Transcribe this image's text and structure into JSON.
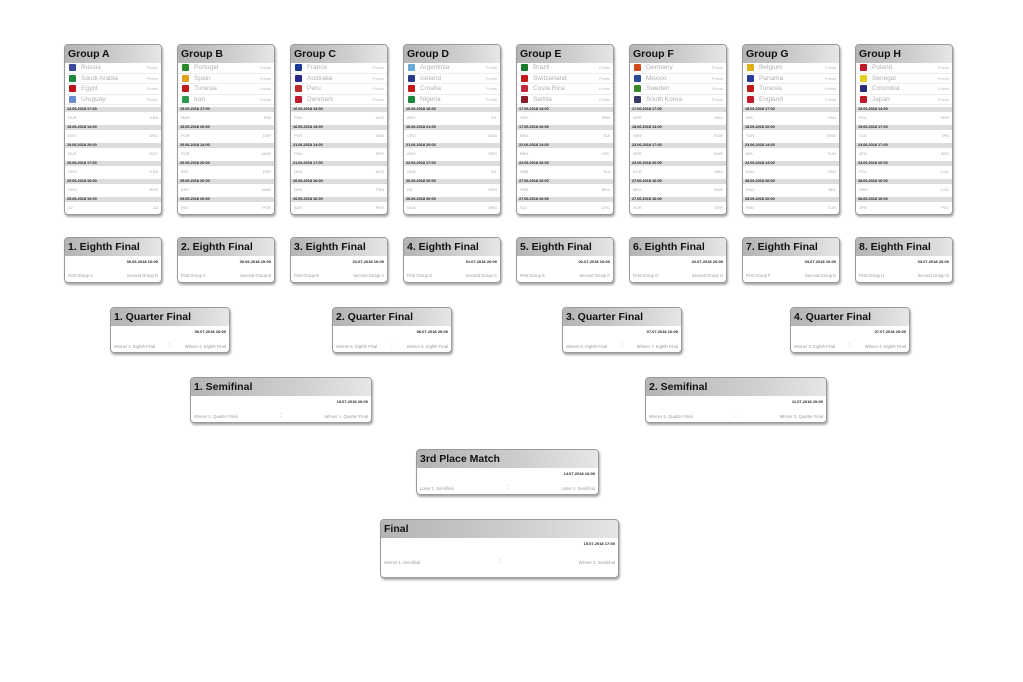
{
  "groups": [
    {
      "title": "Group A",
      "points_label": "Points",
      "teams": [
        {
          "name": "Russia",
          "color": "#3a4a9a"
        },
        {
          "name": "Saudi Arabia",
          "color": "#1a8a3a"
        },
        {
          "name": "Egypt",
          "color": "#c0141c"
        },
        {
          "name": "Uruguay",
          "color": "#6a8ad0"
        }
      ],
      "matches": [
        {
          "date": "14.06.2018 17:00",
          "home": "RUS",
          "away": "KSA"
        },
        {
          "date": "15.06.2018 14:00",
          "home": "EGY",
          "away": "URU"
        },
        {
          "date": "19.06.2018 20:00",
          "home": "RUS",
          "away": "EGY"
        },
        {
          "date": "20.06.2018 17:00",
          "home": "URU",
          "away": "KSA"
        },
        {
          "date": "25.06.2018 16:00",
          "home": "URU",
          "away": "RUS"
        },
        {
          "date": "25.06.2018 16:00",
          "home": "A2",
          "away": "A3"
        }
      ]
    },
    {
      "title": "Group B",
      "points_label": "Points",
      "teams": [
        {
          "name": "Portugal",
          "color": "#2a8a2a"
        },
        {
          "name": "Spain",
          "color": "#e0a020"
        },
        {
          "name": "Tunesia",
          "color": "#c01a1a"
        },
        {
          "name": "Iran",
          "color": "#2a9a4a"
        }
      ],
      "matches": [
        {
          "date": "15.06.2018 17:00",
          "home": "MAR",
          "away": "IRN"
        },
        {
          "date": "15.06.2018 20:00",
          "home": "POR",
          "away": "ESP"
        },
        {
          "date": "20.06.2018 14:00",
          "home": "POR",
          "away": "MAR"
        },
        {
          "date": "20.06.2018 20:00",
          "home": "IRN",
          "away": "ESP"
        },
        {
          "date": "25.06.2018 20:00",
          "home": "ESP",
          "away": "MAR"
        },
        {
          "date": "25.06.2018 20:00",
          "home": "IRN",
          "away": "POR"
        }
      ]
    },
    {
      "title": "Group C",
      "points_label": "Points",
      "teams": [
        {
          "name": "France",
          "color": "#1a3a9a"
        },
        {
          "name": "Australia",
          "color": "#2a2a8a"
        },
        {
          "name": "Peru",
          "color": "#c02a2a"
        },
        {
          "name": "Denmark",
          "color": "#c01a2a"
        }
      ],
      "matches": [
        {
          "date": "16.06.2018 13:00",
          "home": "FRA",
          "away": "AUS"
        },
        {
          "date": "16.06.2018 19:00",
          "home": "PER",
          "away": "DEN"
        },
        {
          "date": "21.06.2018 14:00",
          "home": "FRA",
          "away": "PER"
        },
        {
          "date": "21.06.2018 17:00",
          "home": "DEN",
          "away": "AUS"
        },
        {
          "date": "26.06.2018 16:00",
          "home": "DEN",
          "away": "FRA"
        },
        {
          "date": "26.06.2018 16:00",
          "home": "AUS",
          "away": "PER"
        }
      ]
    },
    {
      "title": "Group D",
      "points_label": "Points",
      "teams": [
        {
          "name": "Argentinia",
          "color": "#6aaad8"
        },
        {
          "name": "Iceland",
          "color": "#2a3a8a"
        },
        {
          "name": "Croatia",
          "color": "#c01a1a"
        },
        {
          "name": "Nigeria",
          "color": "#1a8a3a"
        }
      ],
      "matches": [
        {
          "date": "16.06.2018 16:00",
          "home": "ARG",
          "away": "ISL"
        },
        {
          "date": "16.06.2018 21:00",
          "home": "CRO",
          "away": "NGA"
        },
        {
          "date": "21.06.2018 20:00",
          "home": "ARG",
          "away": "CRO"
        },
        {
          "date": "22.06.2018 17:00",
          "home": "NGA",
          "away": "ISL"
        },
        {
          "date": "26.06.2018 20:00",
          "home": "ISL",
          "away": "CRO"
        },
        {
          "date": "26.06.2018 20:00",
          "home": "NGA",
          "away": "ARG"
        }
      ]
    },
    {
      "title": "Group E",
      "points_label": "Points",
      "teams": [
        {
          "name": "Brazil",
          "color": "#1a7a2a"
        },
        {
          "name": "Switzerland",
          "color": "#c01a1a"
        },
        {
          "name": "Costa Rica",
          "color": "#c02a3a"
        },
        {
          "name": "Serbia",
          "color": "#8a1a2a"
        }
      ],
      "matches": [
        {
          "date": "17.06.2018 14:00",
          "home": "CRC",
          "away": "SRB"
        },
        {
          "date": "17.06.2018 20:00",
          "home": "BRA",
          "away": "SUI"
        },
        {
          "date": "22.06.2018 14:00",
          "home": "BRA",
          "away": "CRC"
        },
        {
          "date": "22.06.2018 20:00",
          "home": "SRB",
          "away": "SUI"
        },
        {
          "date": "27.06.2018 20:00",
          "home": "SRB",
          "away": "BRA"
        },
        {
          "date": "27.06.2018 20:00",
          "home": "SUI",
          "away": "CRC"
        }
      ]
    },
    {
      "title": "Group F",
      "points_label": "Points",
      "teams": [
        {
          "name": "Germany",
          "color": "#d04a1a"
        },
        {
          "name": "Mexico",
          "color": "#2a4a9a"
        },
        {
          "name": "Sweden",
          "color": "#3a8a2a"
        },
        {
          "name": "South Korea",
          "color": "#3a3a6a"
        }
      ],
      "matches": [
        {
          "date": "17.06.2018 17:00",
          "home": "GER",
          "away": "MEX"
        },
        {
          "date": "18.06.2018 14:00",
          "home": "SWE",
          "away": "KOR"
        },
        {
          "date": "23.06.2018 17:00",
          "home": "GER",
          "away": "SWE"
        },
        {
          "date": "23.06.2018 20:00",
          "home": "KOR",
          "away": "MEX"
        },
        {
          "date": "27.06.2018 16:00",
          "home": "MEX",
          "away": "SWE"
        },
        {
          "date": "27.06.2018 16:00",
          "home": "KOR",
          "away": "GER"
        }
      ]
    },
    {
      "title": "Group G",
      "points_label": "Points",
      "teams": [
        {
          "name": "Belgium",
          "color": "#e0b010"
        },
        {
          "name": "Panama",
          "color": "#2a3a9a"
        },
        {
          "name": "Tunesia",
          "color": "#c01a1a"
        },
        {
          "name": "England",
          "color": "#c01a2a"
        }
      ],
      "matches": [
        {
          "date": "18.06.2018 17:00",
          "home": "BEL",
          "away": "PAN"
        },
        {
          "date": "18.06.2018 20:00",
          "home": "TUN",
          "away": "ENG"
        },
        {
          "date": "23.06.2018 14:00",
          "home": "BEL",
          "away": "TUN"
        },
        {
          "date": "24.06.2018 14:00",
          "home": "ENG",
          "away": "PAN"
        },
        {
          "date": "28.06.2018 20:00",
          "home": "ENG",
          "away": "BEL"
        },
        {
          "date": "28.06.2018 20:00",
          "home": "PAN",
          "away": "TUN"
        }
      ]
    },
    {
      "title": "Group H",
      "points_label": "Points",
      "teams": [
        {
          "name": "Poland",
          "color": "#c01a2a"
        },
        {
          "name": "Senegal",
          "color": "#e0d020"
        },
        {
          "name": "Colombia",
          "color": "#2a2a7a"
        },
        {
          "name": "Japan",
          "color": "#c01a2a"
        }
      ],
      "matches": [
        {
          "date": "19.06.2018 14:00",
          "home": "POL",
          "away": "SEN"
        },
        {
          "date": "19.06.2018 17:00",
          "home": "COL",
          "away": "JPN"
        },
        {
          "date": "24.06.2018 17:00",
          "home": "JPN",
          "away": "SEN"
        },
        {
          "date": "24.06.2018 20:00",
          "home": "POL",
          "away": "COL"
        },
        {
          "date": "28.06.2018 16:00",
          "home": "SEN",
          "away": "COL"
        },
        {
          "date": "28.06.2018 16:00",
          "home": "JPN",
          "away": "POL"
        }
      ]
    }
  ],
  "knockout": [
    {
      "stage": "eighth",
      "title": "1. Eighth Final",
      "date": "30.06.2018 16:00",
      "home": "First Group C",
      "away": "Second Group D"
    },
    {
      "stage": "eighth",
      "title": "2. Eighth Final",
      "date": "30.06.2018 20:00",
      "home": "First Group A",
      "away": "Second Group B"
    },
    {
      "stage": "eighth",
      "title": "3. Eighth Final",
      "date": "01.07.2018 16:00",
      "home": "First Group B",
      "away": "Second Group A"
    },
    {
      "stage": "eighth",
      "title": "4. Eighth Final",
      "date": "01.07.2018 20:00",
      "home": "First Group D",
      "away": "Second Group C"
    },
    {
      "stage": "eighth",
      "title": "5. Eighth Final",
      "date": "02.07.2018 16:00",
      "home": "First Group E",
      "away": "Second Group F"
    },
    {
      "stage": "eighth",
      "title": "6. Eighth Final",
      "date": "02.07.2018 20:00",
      "home": "First Group G",
      "away": "Second Group H"
    },
    {
      "stage": "eighth",
      "title": "7. Eighth Final",
      "date": "03.07.2018 16:00",
      "home": "First Group F",
      "away": "Second Group E"
    },
    {
      "stage": "eighth",
      "title": "8. Eighth Final",
      "date": "03.07.2018 20:00",
      "home": "First Group H",
      "away": "Second Group G"
    },
    {
      "stage": "quarter",
      "title": "1. Quarter Final",
      "date": "06.07.2018 16:00",
      "home": "Winner 1. Eighth Final",
      "away": "Winner 2. Eighth Final"
    },
    {
      "stage": "quarter",
      "title": "2. Quarter Final",
      "date": "06.07.2018 20:00",
      "home": "Winner 5. Eighth Final",
      "away": "Winner 6. Eighth Final"
    },
    {
      "stage": "quarter",
      "title": "3. Quarter Final",
      "date": "07.07.2018 16:00",
      "home": "Winner 8. Eighth Final",
      "away": "Winner 7. Eighth Final"
    },
    {
      "stage": "quarter",
      "title": "4. Quarter Final",
      "date": "07.07.2018 20:00",
      "home": "Winner 3. Eighth Final",
      "away": "Winner 4. Eighth Final"
    },
    {
      "stage": "semi",
      "title": "1. Semifinal",
      "date": "10.07.2018 20:00",
      "home": "Winner 2. Quarter Final",
      "away": "Winner 1. Quarter Final"
    },
    {
      "stage": "semi",
      "title": "2. Semifinal",
      "date": "11.07.2018 20:00",
      "home": "Winner 4. Quarter Final",
      "away": "Winner 3. Quarter Final"
    },
    {
      "stage": "third",
      "title": "3rd Place Match",
      "date": "14.07.2018 16:00",
      "home": "Loser 1. Semifinal",
      "away": "Loser 2. Semifinal"
    },
    {
      "stage": "final",
      "title": "Final",
      "date": "15.07.2018 17:00",
      "home": "Winner 1. Semifinal",
      "away": "Winner 2. Semifinal"
    }
  ],
  "separator": ":"
}
